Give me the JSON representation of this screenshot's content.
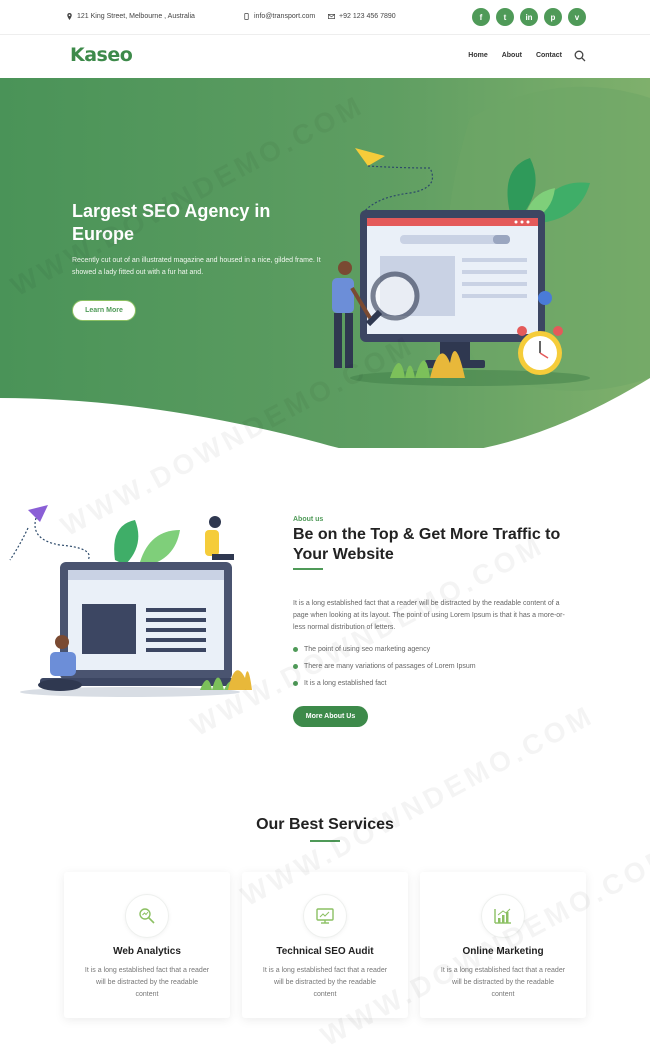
{
  "topbar": {
    "address": "121 King Street, Melbourne , Australia",
    "email": "info@transport.com",
    "phone": "+92 123 456 7890",
    "social": [
      "f",
      "t",
      "in",
      "p",
      "v"
    ]
  },
  "nav": {
    "logo": "Kaseo",
    "items": [
      "Home",
      "About",
      "Contact"
    ]
  },
  "hero": {
    "title": "Largest SEO Agency in Europe",
    "text": "Recently cut out of an illustrated magazine and housed in a nice, gilded frame. It showed a lady fitted out with a fur hat and.",
    "button": "Learn More"
  },
  "about": {
    "subtitle": "About us",
    "title": "Be on the Top & Get More Traffic to Your Website",
    "text": "It is a long established fact that a reader will be distracted by the readable content of a page when looking at its layout. The point of using Lorem Ipsum is that it has a more-or-less normal distribution of letters.",
    "bullets": [
      "The point of using seo marketing agency",
      "There are many variations of passages of Lorem Ipsum",
      "It is a long established fact"
    ],
    "button": "More About Us"
  },
  "services": {
    "title": "Our Best Services",
    "cards": [
      {
        "title": "Web Analytics",
        "text": "It is a long established fact that a reader will be distracted by the readable content",
        "icon": "analytics-icon"
      },
      {
        "title": "Technical SEO Audit",
        "text": "It is a long established fact that a reader will be distracted by the readable content",
        "icon": "monitor-audit-icon"
      },
      {
        "title": "Online Marketing",
        "text": "It is a long established fact that a reader will be distracted by the readable content",
        "icon": "chart-growth-icon"
      }
    ]
  },
  "colors": {
    "primary": "#4f9a58",
    "dark": "#3d8a4a",
    "accent": "#8cc063"
  },
  "watermark": "WWW.DOWNDEMO.COM"
}
